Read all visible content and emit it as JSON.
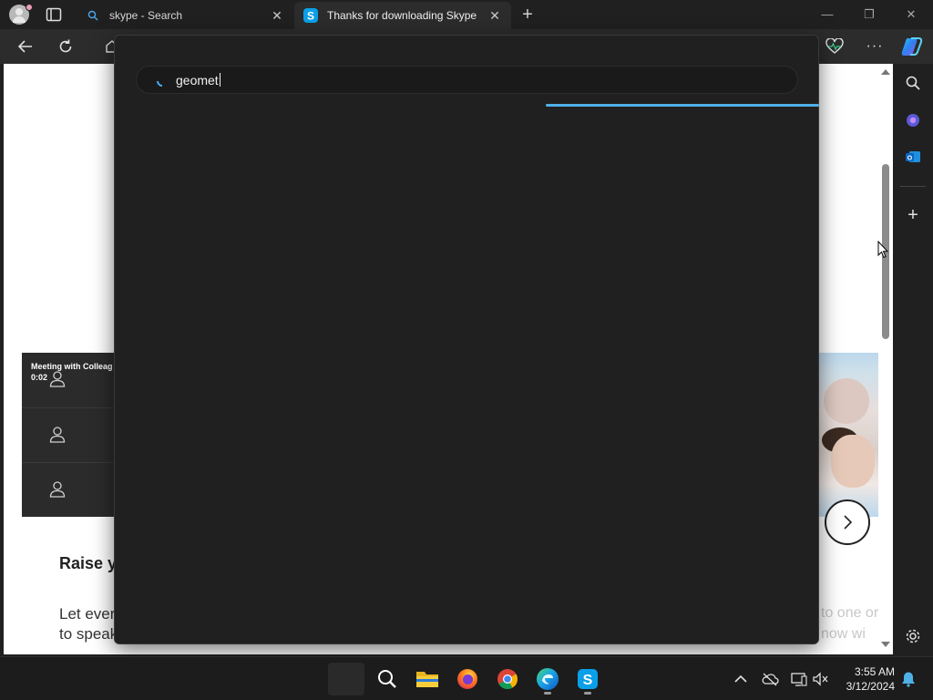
{
  "browser": {
    "tabs": [
      {
        "label": "skype - Search",
        "icon": "search-icon",
        "active": true
      },
      {
        "label": "Thanks for downloading Skype",
        "icon": "skype-icon",
        "active": false
      }
    ],
    "window_controls": [
      "minimize",
      "restore",
      "close"
    ]
  },
  "page": {
    "meeting_title": "Meeting with Colleag",
    "meeting_time": "0:02",
    "heading": "Raise y",
    "body_line1": "Let ever",
    "body_line2": "to speak",
    "right_line1": "to one or",
    "right_line2": "now wi"
  },
  "search": {
    "query": "geomet",
    "progress_color": "#4fb1e8"
  },
  "taskbar": {
    "apps": [
      "start",
      "search",
      "file-explorer",
      "firefox",
      "chrome",
      "edge",
      "skype"
    ],
    "time": "3:55 AM",
    "date": "3/12/2024"
  },
  "colors": {
    "overlay_bg": "#202020",
    "accent": "#4fb1e8",
    "skype_blue": "#0aa0e8"
  }
}
